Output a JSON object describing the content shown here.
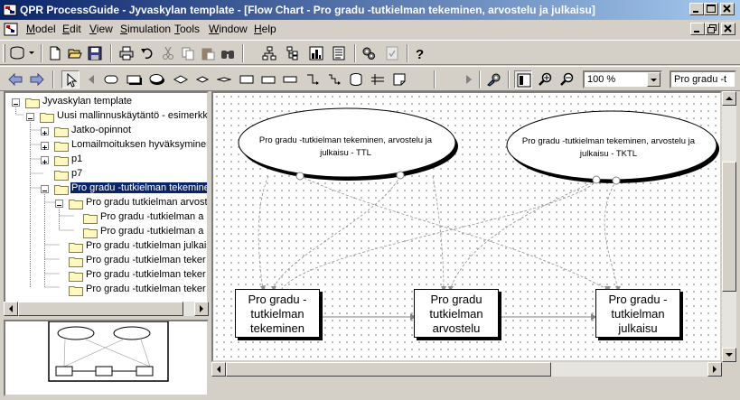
{
  "window": {
    "title": "QPR ProcessGuide - Jyvaskylan template - [Flow Chart - Pro gradu -tutkielman tekeminen, arvostelu ja julkaisu]"
  },
  "menu": {
    "items": [
      "Model",
      "Edit",
      "View",
      "Simulation",
      "Tools",
      "Window",
      "Help"
    ]
  },
  "toolbar2": {
    "zoom_value": "100 %",
    "object_combo_value": "Pro gradu -t"
  },
  "tree": {
    "nodes": [
      {
        "label": "Jyvaskylan template"
      },
      {
        "label": "Uusi mallinnuskäytäntö - esimerkke"
      },
      {
        "label": "Jatko-opinnot"
      },
      {
        "label": "Lomailmoituksen hyväksyminen"
      },
      {
        "label": "p1"
      },
      {
        "label": "p7"
      },
      {
        "label": "Pro gradu -tutkielman tekeminen"
      },
      {
        "label": "Pro gradu tutkielman arvostel"
      },
      {
        "label": "Pro gradu -tutkielman a"
      },
      {
        "label": "Pro gradu -tutkielman a"
      },
      {
        "label": "Pro gradu -tutkielman julkaisu"
      },
      {
        "label": "Pro gradu -tutkielman teker"
      },
      {
        "label": "Pro gradu -tutkielman teker"
      },
      {
        "label": "Pro gradu -tutkielman teker"
      }
    ]
  },
  "diagram": {
    "ellipse_left": "Pro gradu -tutkielman tekeminen, arvostelu ja julkaisu - TTL",
    "ellipse_right": "Pro gradu -tutkielman tekeminen, arvostelu ja julkaisu - TKTL",
    "process_1": "Pro gradu -tutkielman tekeminen",
    "process_2": "Pro gradu tutkielman arvostelu",
    "process_3": "Pro gradu -tutkielman julkaisu"
  }
}
